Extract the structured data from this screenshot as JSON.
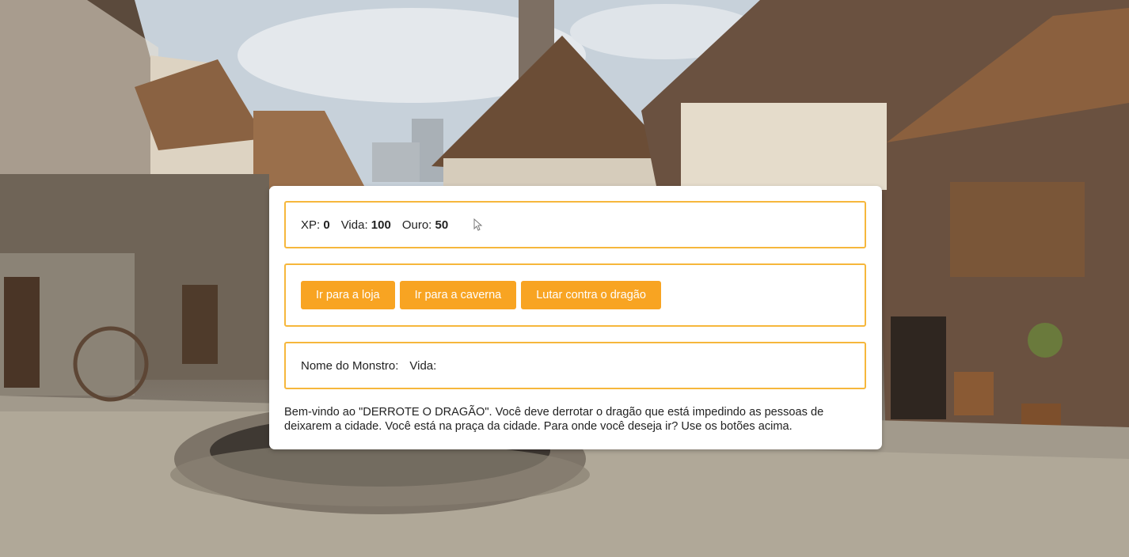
{
  "stats": {
    "xp_label": "XP:",
    "xp_value": "0",
    "health_label": "Vida:",
    "health_value": "100",
    "gold_label": "Ouro:",
    "gold_value": "50"
  },
  "controls": {
    "button1": "Ir para a loja",
    "button2": "Ir para a caverna",
    "button3": "Lutar contra o dragão"
  },
  "monster": {
    "name_label": "Nome do Monstro:",
    "health_label": "Vida:"
  },
  "text": "Bem-vindo ao \"DERROTE O DRAGÃO\". Você deve derrotar o dragão que está impedindo as pessoas de deixarem a cidade. Você está na praça da cidade. Para onde você deseja ir? Use os botões acima.",
  "colors": {
    "accent": "#f8a422",
    "border": "#f6b73c"
  }
}
